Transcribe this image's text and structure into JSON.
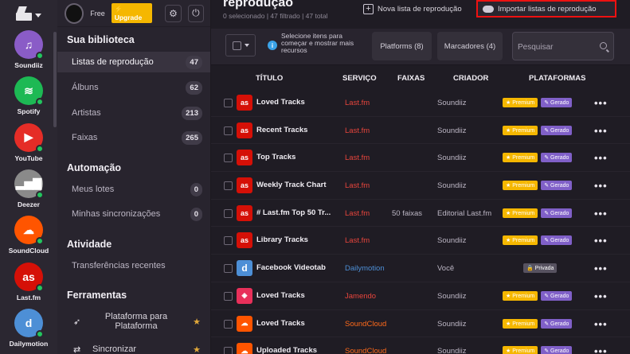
{
  "user": {
    "plan": "Free",
    "upgrade_label": "Upgrade"
  },
  "rail": {
    "services": [
      {
        "name": "Soundiiz",
        "color": "#8a5cc7",
        "glyph": "♫"
      },
      {
        "name": "Spotify",
        "color": "#1db954",
        "glyph": "≋"
      },
      {
        "name": "YouTube",
        "color": "#e52d27",
        "glyph": "▶"
      },
      {
        "name": "Deezer",
        "color": "#8a8a8a",
        "glyph": "▂▅▇"
      },
      {
        "name": "SoundCloud",
        "color": "#ff5500",
        "glyph": "☁"
      },
      {
        "name": "Last.fm",
        "color": "#d51007",
        "glyph": "as"
      },
      {
        "name": "Dailymotion",
        "color": "#4d8fd6",
        "glyph": "d"
      }
    ]
  },
  "sidebar": {
    "library_title": "Sua biblioteca",
    "library": [
      {
        "label": "Listas de reprodução",
        "count": "47"
      },
      {
        "label": "Álbuns",
        "count": "62"
      },
      {
        "label": "Artistas",
        "count": "213"
      },
      {
        "label": "Faixas",
        "count": "265"
      }
    ],
    "automation_title": "Automação",
    "automation": [
      {
        "label": "Meus lotes",
        "count": "0"
      },
      {
        "label": "Minhas sincronizações",
        "count": "0"
      }
    ],
    "activity_title": "Atividade",
    "activity": [
      {
        "label": "Transferências recentes"
      }
    ],
    "tools_title": "Ferramentas",
    "tools": [
      {
        "label": "Plataforma para Plataforma"
      },
      {
        "label": "Sincronizar"
      }
    ]
  },
  "main": {
    "title": "reprodução",
    "stats": "0 selecionado | 47 filtrado | 47 total",
    "new_playlist_label": "Nova lista de reprodução",
    "import_label": "Importar listas de reprodução",
    "hint": "Selecione itens para começar e mostrar mais recursos",
    "platforms_filter": "Platforms (8)",
    "tags_filter": "Marcadores (4)",
    "search_placeholder": "Pesquisar"
  },
  "table": {
    "headers": {
      "title": "TÍTULO",
      "service": "SERVIÇO",
      "tracks": "FAIXAS",
      "creator": "CRIADOR",
      "platforms": "PLATAFORMAS"
    },
    "rows": [
      {
        "title": "Loved Tracks",
        "service": "Last.fm",
        "service_color": "#e8453c",
        "tracks": "",
        "creator": "Soundiiz",
        "cover": "as",
        "cover_color": "#d51007",
        "badges": [
          "Premium",
          "Gerado"
        ]
      },
      {
        "title": "Recent Tracks",
        "service": "Last.fm",
        "service_color": "#e8453c",
        "tracks": "",
        "creator": "Soundiiz",
        "cover": "as",
        "cover_color": "#d51007",
        "badges": [
          "Premium",
          "Gerado"
        ]
      },
      {
        "title": "Top Tracks",
        "service": "Last.fm",
        "service_color": "#e8453c",
        "tracks": "",
        "creator": "Soundiiz",
        "cover": "as",
        "cover_color": "#d51007",
        "badges": [
          "Premium",
          "Gerado"
        ]
      },
      {
        "title": "Weekly Track Chart",
        "service": "Last.fm",
        "service_color": "#e8453c",
        "tracks": "",
        "creator": "Soundiiz",
        "cover": "as",
        "cover_color": "#d51007",
        "badges": [
          "Premium",
          "Gerado"
        ]
      },
      {
        "title": "# Last.fm Top 50 Tr...",
        "service": "Last.fm",
        "service_color": "#e8453c",
        "tracks": "50 faixas",
        "creator": "Editorial Last.fm",
        "cover": "as",
        "cover_color": "#d51007",
        "badges": [
          "Premium",
          "Gerado"
        ]
      },
      {
        "title": "Library Tracks",
        "service": "Last.fm",
        "service_color": "#e8453c",
        "tracks": "",
        "creator": "Soundiiz",
        "cover": "as",
        "cover_color": "#d51007",
        "badges": [
          "Premium",
          "Gerado"
        ]
      },
      {
        "title": "Facebook Videotab",
        "service": "Dailymotion",
        "service_color": "#4d8fd6",
        "tracks": "",
        "creator": "Você",
        "cover": "d",
        "cover_color": "#4d8fd6",
        "badges": [
          "Privada"
        ]
      },
      {
        "title": "Loved Tracks",
        "service": "Jamendo",
        "service_color": "#e8453c",
        "tracks": "",
        "creator": "Soundiiz",
        "cover": "◈",
        "cover_color": "#e8305a",
        "badges": [
          "Premium",
          "Gerado"
        ]
      },
      {
        "title": "Loved Tracks",
        "service": "SoundCloud",
        "service_color": "#ff6a1a",
        "tracks": "",
        "creator": "Soundiiz",
        "cover": "☁",
        "cover_color": "#ff5500",
        "badges": [
          "Premium",
          "Gerado"
        ]
      },
      {
        "title": "Uploaded Tracks",
        "service": "SoundCloud",
        "service_color": "#ff6a1a",
        "tracks": "",
        "creator": "Soundiiz",
        "cover": "☁",
        "cover_color": "#ff5500",
        "badges": [
          "Premium",
          "Gerado"
        ]
      }
    ]
  },
  "badge_labels": {
    "Premium": "★ Premium",
    "Gerado": "✎ Gerado",
    "Privada": "🔒 Privada"
  },
  "colors": {
    "accent": "#f5b700",
    "import_highlight": "#ee1111",
    "generated": "#8060c8"
  }
}
